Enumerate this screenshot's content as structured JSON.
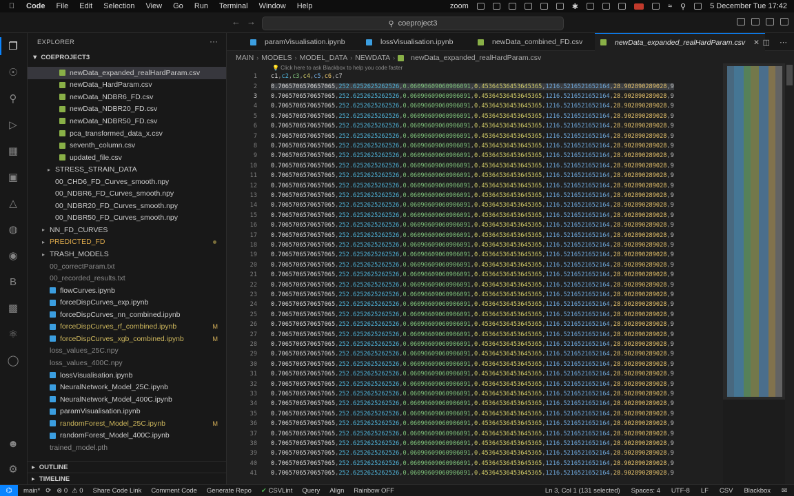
{
  "menubar": {
    "app": "Code",
    "items": [
      "File",
      "Edit",
      "Selection",
      "View",
      "Go",
      "Run",
      "Terminal",
      "Window",
      "Help"
    ],
    "zoom": "zoom",
    "clock": "5 December Tue  17:42"
  },
  "titlebar": {
    "search": "coeproject3"
  },
  "explorer": {
    "title": "EXPLORER",
    "more": "···",
    "project": "COEPROJECT3",
    "outline": "OUTLINE",
    "timeline": "TIMELINE",
    "items": [
      {
        "label": "newData_expanded_realHardParam.csv",
        "type": "csv",
        "indent": 2,
        "selected": true
      },
      {
        "label": "newData_HardParam.csv",
        "type": "csv",
        "indent": 2
      },
      {
        "label": "newData_NDBR6_FD.csv",
        "type": "csv",
        "indent": 2
      },
      {
        "label": "newData_NDBR20_FD.csv",
        "type": "csv",
        "indent": 2
      },
      {
        "label": "newData_NDBR50_FD.csv",
        "type": "csv",
        "indent": 2
      },
      {
        "label": "pca_transformed_data_x.csv",
        "type": "csv",
        "indent": 2
      },
      {
        "label": "seventh_column.csv",
        "type": "csv",
        "indent": 2
      },
      {
        "label": "updated_file.csv",
        "type": "csv",
        "indent": 2
      },
      {
        "label": "STRESS_STRAIN_DATA",
        "type": "folder",
        "indent": 1
      },
      {
        "label": "00_CHD6_FD_Curves_smooth.npy",
        "type": "npy",
        "indent": 1
      },
      {
        "label": "00_NDBR6_FD_Curves_smooth.npy",
        "type": "npy",
        "indent": 1
      },
      {
        "label": "00_NDBR20_FD_Curves_smooth.npy",
        "type": "npy",
        "indent": 1
      },
      {
        "label": "00_NDBR50_FD_Curves_smooth.npy",
        "type": "npy",
        "indent": 1
      },
      {
        "label": "NN_FD_CURVES",
        "type": "folder",
        "indent": 0
      },
      {
        "label": "PREDICTED_FD",
        "type": "folder",
        "indent": 0,
        "color": "orange",
        "dot": true
      },
      {
        "label": "TRASH_MODELS",
        "type": "folder",
        "indent": 0
      },
      {
        "label": "00_correctParam.txt",
        "type": "txt",
        "indent": 0,
        "color": "gray"
      },
      {
        "label": "00_recorded_results.txt",
        "type": "txt",
        "indent": 0,
        "color": "gray"
      },
      {
        "label": "flowCurves.ipynb",
        "type": "ipynb",
        "indent": 0
      },
      {
        "label": "forceDispCurves_exp.ipynb",
        "type": "ipynb",
        "indent": 0
      },
      {
        "label": "forceDispCurves_nn_combined.ipynb",
        "type": "ipynb",
        "indent": 0
      },
      {
        "label": "forceDispCurves_rf_combined.ipynb",
        "type": "ipynb",
        "indent": 0,
        "color": "yellow",
        "badge": "M"
      },
      {
        "label": "forceDispCurves_xgb_combined.ipynb",
        "type": "ipynb",
        "indent": 0,
        "color": "yellow",
        "badge": "M"
      },
      {
        "label": "loss_values_25C.npy",
        "type": "npy",
        "indent": 0,
        "color": "gray"
      },
      {
        "label": "loss_values_400C.npy",
        "type": "npy",
        "indent": 0,
        "color": "gray"
      },
      {
        "label": "lossVisualisation.ipynb",
        "type": "ipynb",
        "indent": 0
      },
      {
        "label": "NeuralNetwork_Model_25C.ipynb",
        "type": "ipynb",
        "indent": 0
      },
      {
        "label": "NeuralNetwork_Model_400C.ipynb",
        "type": "ipynb",
        "indent": 0
      },
      {
        "label": "paramVisualisation.ipynb",
        "type": "ipynb",
        "indent": 0
      },
      {
        "label": "randomForest_Model_25C.ipynb",
        "type": "ipynb",
        "indent": 0,
        "color": "yellow",
        "badge": "M"
      },
      {
        "label": "randomForest_Model_400C.ipynb",
        "type": "ipynb",
        "indent": 0
      },
      {
        "label": "trained_model.pth",
        "type": "pth",
        "indent": 0,
        "color": "gray"
      }
    ]
  },
  "tabs": [
    {
      "label": "paramVisualisation.ipynb",
      "type": "ipynb"
    },
    {
      "label": "lossVisualisation.ipynb",
      "type": "ipynb"
    },
    {
      "label": "newData_combined_FD.csv",
      "type": "csv"
    },
    {
      "label": "newData_expanded_realHardParam.csv",
      "type": "csv",
      "active": true
    }
  ],
  "breadcrumb": [
    "MAIN",
    "MODELS",
    "MODEL_DATA",
    "NEWDATA",
    "newData_expanded_realHardParam.csv"
  ],
  "editor": {
    "hint": "💡 Click here to ask Blackbox to help you code faster",
    "header_fields": [
      "c1",
      "c2",
      "c3",
      "c4",
      "c5",
      "c6",
      "c7"
    ],
    "row_fields": [
      "0.7065706570657065",
      "252.6252625262526",
      "0.06090609060906091",
      "0.45364536453645365",
      "1216.5216521652164",
      "28.902890289028",
      "9"
    ],
    "line_count": 41,
    "current_line": 3
  },
  "statusbar": {
    "remote_icon": "⌬",
    "branch": "main*",
    "sync": "⟳",
    "errors": "⊗ 0",
    "warnings": "⚠ 0",
    "share": "Share Code Link",
    "comment": "Comment Code",
    "generate": "Generate Repo",
    "csvlint": "CSVLint",
    "query": "Query",
    "align": "Align",
    "rainbow": "Rainbow OFF",
    "position": "Ln 3, Col 1 (131 selected)",
    "spaces": "Spaces: 4",
    "encoding": "UTF-8",
    "eol": "LF",
    "language": "CSV",
    "blackbox": "Blackbox"
  }
}
